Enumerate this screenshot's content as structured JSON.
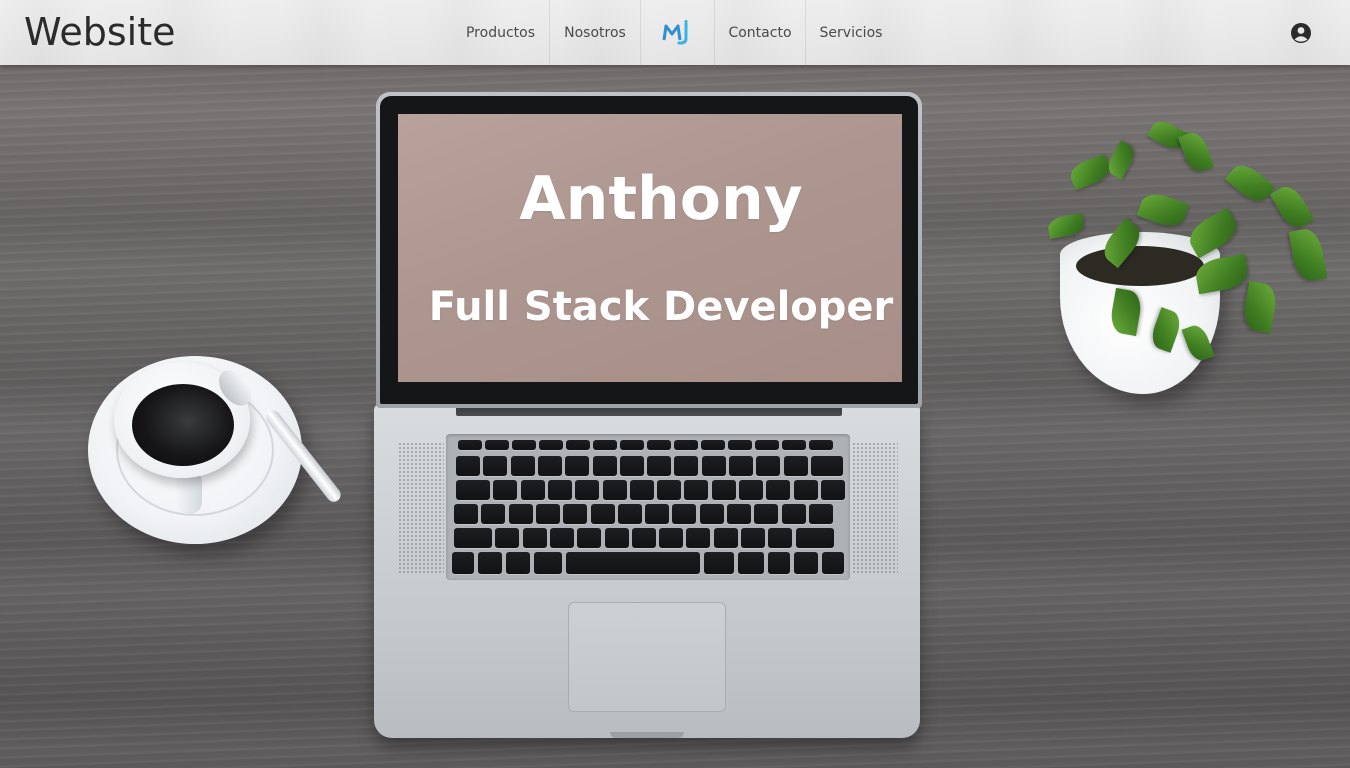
{
  "header": {
    "brand": "Website",
    "nav": [
      {
        "label": "Productos"
      },
      {
        "label": "Nosotros"
      },
      {
        "label": "Contacto"
      },
      {
        "label": "Servicios"
      }
    ],
    "logo_icon": "mj-logo-icon",
    "user_icon": "account-circle-icon"
  },
  "hero": {
    "name": "Anthony",
    "role": "Full Stack Developer"
  },
  "colors": {
    "navbar_bg": "#e8e8e8",
    "brand_text": "#2b2b2b",
    "nav_text": "#4a4a4a",
    "logo_accent": "#2f8fd0",
    "hero_text": "#ffffff"
  }
}
